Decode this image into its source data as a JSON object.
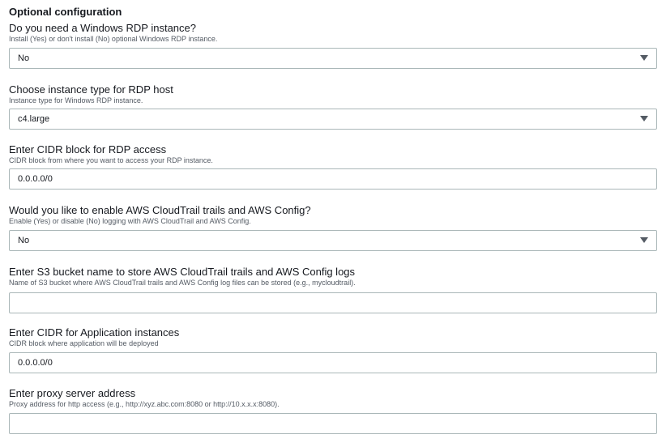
{
  "section": {
    "title": "Optional configuration"
  },
  "fields": [
    {
      "label": "Do you need a Windows RDP instance?",
      "description": "Install (Yes) or don't install (No) optional Windows RDP instance.",
      "type": "select",
      "value": "No",
      "icon": "chevron-down-icon"
    },
    {
      "label": "Choose instance type for RDP host",
      "description": "Instance type for Windows RDP instance.",
      "type": "select",
      "value": "c4.large",
      "icon": "chevron-down-icon"
    },
    {
      "label": "Enter CIDR block for RDP access",
      "description": "CIDR block from where you want to access your RDP instance.",
      "type": "text",
      "value": "0.0.0.0/0"
    },
    {
      "label": "Would you like to enable AWS CloudTrail trails and AWS Config?",
      "description": "Enable (Yes) or disable (No) logging with AWS CloudTrail and AWS Config.",
      "type": "select",
      "value": "No",
      "icon": "chevron-down-icon"
    },
    {
      "label": "Enter S3 bucket name to store AWS CloudTrail trails and AWS Config logs",
      "description": "Name of S3 bucket where AWS CloudTrail trails and AWS Config log files can be stored (e.g., mycloudtrail).",
      "type": "text",
      "value": ""
    },
    {
      "label": "Enter CIDR for Application instances",
      "description": "CIDR block where application will be deployed",
      "type": "text",
      "value": "0.0.0.0/0"
    },
    {
      "label": "Enter proxy server address",
      "description": "Proxy address for http access (e.g., http://xyz.abc.com:8080 or http://10.x.x.x:8080).",
      "type": "text",
      "value": ""
    }
  ]
}
